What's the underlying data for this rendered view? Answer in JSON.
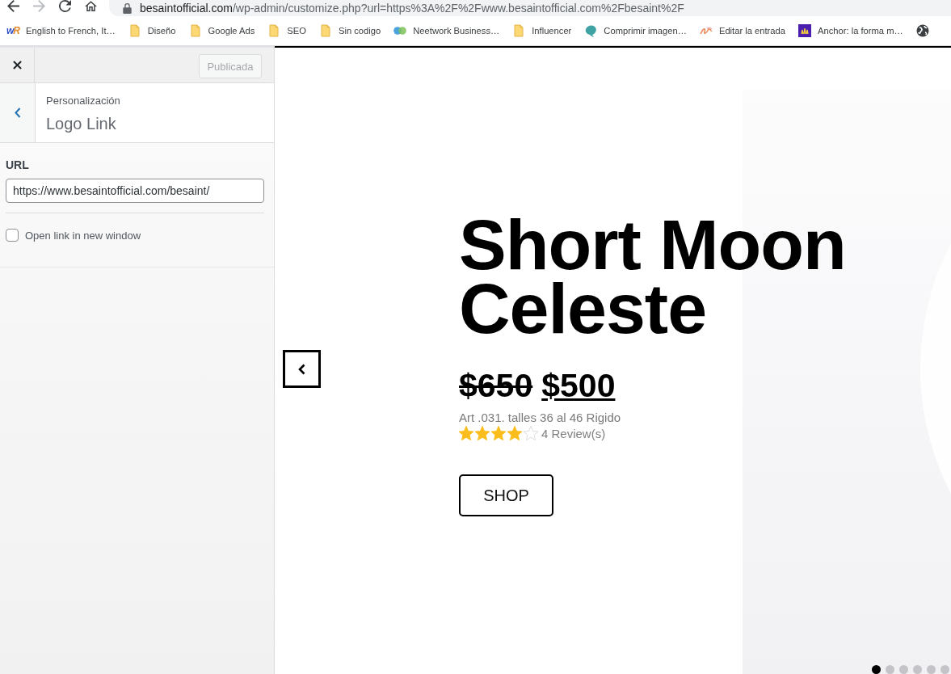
{
  "browser": {
    "nav_buttons": [
      {
        "kind": "back",
        "disabled": false
      },
      {
        "kind": "forward",
        "disabled": true
      },
      {
        "kind": "reload",
        "disabled": false
      },
      {
        "kind": "home",
        "disabled": false
      }
    ],
    "address": {
      "host": "besaintofficial.com",
      "path": "/wp-admin/customize.php?url=https%3A%2F%2Fwww.besaintofficial.com%2Fbesaint%2F"
    },
    "bookmarks": [
      {
        "kind": "text_logo",
        "logo": "wR",
        "label": "English to French, It…"
      },
      {
        "kind": "folder",
        "label": "Diseño"
      },
      {
        "kind": "folder",
        "label": "Google Ads"
      },
      {
        "kind": "folder",
        "label": "SEO"
      },
      {
        "kind": "folder",
        "label": "Sin codigo"
      },
      {
        "kind": "circles",
        "label": "Neetwork Business…"
      },
      {
        "kind": "folder",
        "label": "Influencer"
      },
      {
        "kind": "leaf",
        "label": "Comprimir imagen…"
      },
      {
        "kind": "scribble",
        "label": "Editar la entrada"
      },
      {
        "kind": "square",
        "label": "Anchor: la forma m…"
      },
      {
        "kind": "globe"
      }
    ]
  },
  "customizer": {
    "publish_button": {
      "label": "Publicada",
      "disabled": true
    },
    "section": {
      "parent": "Personalización",
      "title": "Logo Link"
    },
    "url_field": {
      "label": "URL",
      "value": "https://www.besaintofficial.com/besaint/"
    },
    "new_window_option": {
      "label": "Open link in new window",
      "checked": false
    }
  },
  "preview": {
    "slide": {
      "title": "Short Moon Celeste",
      "old_price": "$650",
      "price": "$500",
      "description": "Art .031. talles 36 al 46 Rigido",
      "stars": 4,
      "reviews": "4 Review(s)",
      "button": "SHOP"
    },
    "dots": [
      {
        "selected": true
      },
      {
        "selected": false
      },
      {
        "selected": false
      },
      {
        "selected": false
      },
      {
        "selected": false
      },
      {
        "selected": false
      }
    ]
  }
}
